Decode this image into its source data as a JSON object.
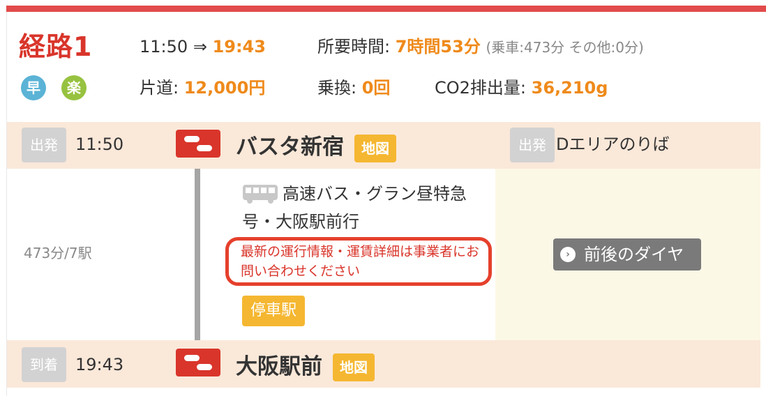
{
  "route": {
    "title": "経路1",
    "badges": [
      "早",
      "楽"
    ],
    "depart_time": "11:50",
    "arrow": "⇒",
    "arrive_time": "19:43",
    "duration_label": "所要時間: ",
    "duration_value": "7時間53分",
    "duration_detail": "(乗車:473分 その他:0分)",
    "fare_label": "片道: ",
    "fare_value": "12,000円",
    "transfer_label": "乗換: ",
    "transfer_value": "0回",
    "co2_label": "CO2排出量: ",
    "co2_value": "36,210g"
  },
  "departure": {
    "tag": "出発",
    "time": "11:50",
    "station": "バスタ新宿",
    "map_label": "地図",
    "platform_tag": "出発",
    "platform": "Dエリアのりば"
  },
  "segment": {
    "duration": "473分/7駅",
    "line_name": "高速バス・グラン昼特急号・大阪駅前行",
    "notice": "最新の運行情報・運賃詳細は事業者にお問い合わせください",
    "stops_label": "停車駅",
    "dia_label": "前後のダイヤ"
  },
  "arrival": {
    "tag": "到着",
    "time": "19:43",
    "station": "大阪駅前",
    "map_label": "地図"
  },
  "colors": {
    "accent_red": "#d9352b",
    "accent_orange": "#ef8a1b",
    "button_yellow": "#f5b731"
  }
}
